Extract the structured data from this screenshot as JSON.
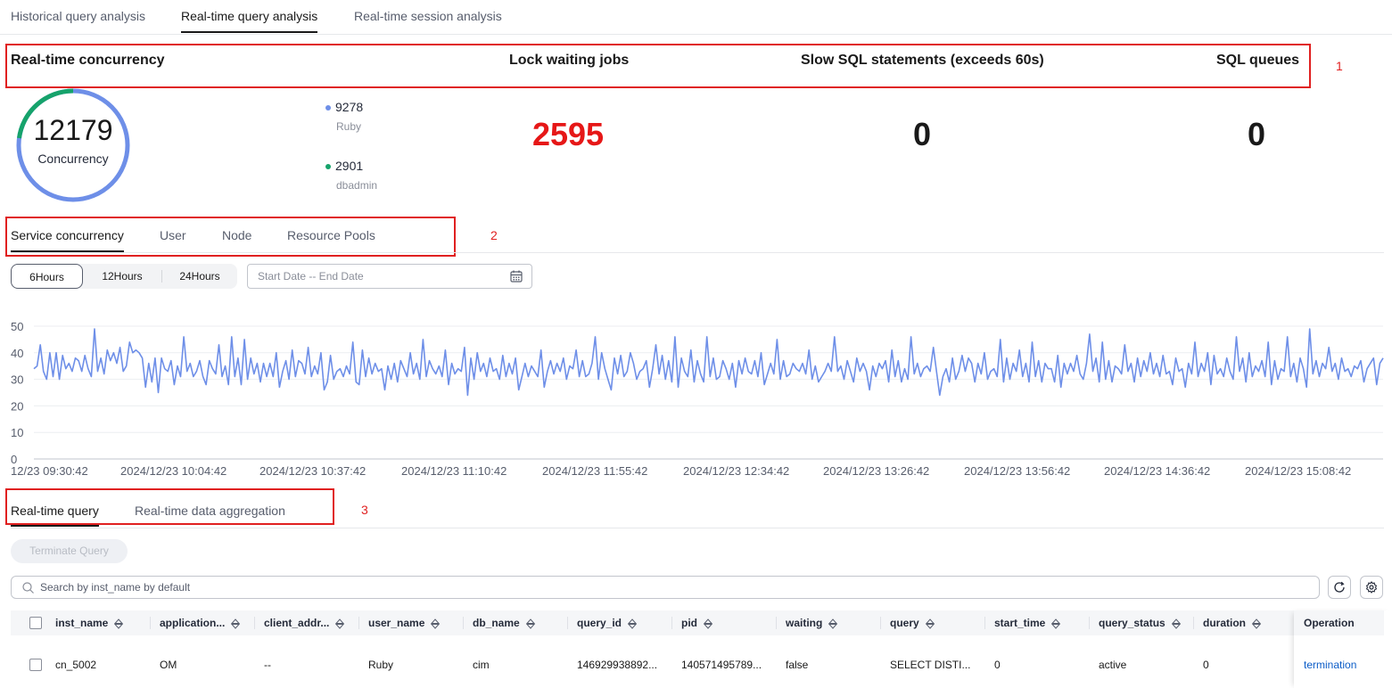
{
  "top_tabs": [
    "Historical query analysis",
    "Real-time query analysis",
    "Real-time session analysis"
  ],
  "metrics": {
    "realtime_title": "Real-time concurrency",
    "lock_title": "Lock waiting jobs",
    "slow_title": "Slow SQL statements (exceeds 60s)",
    "queues_title": "SQL queues",
    "concurrency_value": "12179",
    "concurrency_label": "Concurrency",
    "lock_value": "2595",
    "slow_value": "0",
    "queues_value": "0",
    "breakdown": [
      {
        "value": "9278",
        "user": "Ruby",
        "color": "#6e8fe8"
      },
      {
        "value": "2901",
        "user": "dbadmin",
        "color": "#16a36b"
      }
    ]
  },
  "annotations": [
    "1",
    "2",
    "3"
  ],
  "service_tabs": [
    "Service concurrency",
    "User",
    "Node",
    "Resource Pools"
  ],
  "time_range": {
    "options": [
      "6Hours",
      "12Hours",
      "24Hours"
    ],
    "selected": "6Hours",
    "date_placeholder": "Start Date -- End Date"
  },
  "chart_data": {
    "type": "line",
    "ylim": [
      0,
      50
    ],
    "yticks": [
      0,
      10,
      20,
      30,
      40,
      50
    ],
    "x_tick_labels": [
      "12/23 09:30:42",
      "2024/12/23 10:04:42",
      "2024/12/23 10:37:42",
      "2024/12/23 11:10:42",
      "2024/12/23 11:55:42",
      "2024/12/23 12:34:42",
      "2024/12/23 13:26:42",
      "2024/12/23 13:56:42",
      "2024/12/23 14:36:42",
      "2024/12/23 15:08:42"
    ],
    "color": "#6e8fe8",
    "series": [
      {
        "values": [
          34,
          35,
          43,
          33,
          30,
          40,
          31,
          40,
          30,
          39,
          34,
          36,
          33,
          38,
          37,
          33,
          39,
          34,
          31,
          49,
          33,
          38,
          32,
          41,
          37,
          40,
          36,
          42,
          33,
          35,
          44,
          40,
          41,
          40,
          38,
          27,
          36,
          29,
          38,
          25,
          38,
          34,
          33,
          37,
          28,
          35,
          31,
          46,
          33,
          36,
          31,
          33,
          37,
          31,
          28,
          37,
          34,
          32,
          43,
          31,
          35,
          28,
          46,
          31,
          38,
          28,
          45,
          30,
          38,
          32,
          36,
          29,
          36,
          31,
          36,
          31,
          40,
          27,
          33,
          37,
          30,
          41,
          31,
          37,
          36,
          32,
          42,
          31,
          35,
          32,
          40,
          26,
          29,
          39,
          30,
          33,
          34,
          31,
          35,
          32,
          44,
          29,
          28,
          41,
          31,
          38,
          32,
          36,
          33,
          34,
          26,
          35,
          30,
          36,
          29,
          37,
          34,
          31,
          40,
          32,
          36,
          30,
          45,
          31,
          37,
          34,
          32,
          35,
          31,
          41,
          28,
          36,
          32,
          34,
          33,
          42,
          24,
          38,
          30,
          40,
          33,
          36,
          31,
          38,
          33,
          34,
          30,
          39,
          31,
          36,
          32,
          38,
          26,
          31,
          36,
          31,
          35,
          33,
          31,
          41,
          27,
          33,
          37,
          32,
          36,
          33,
          38,
          30,
          35,
          34,
          41,
          31,
          37,
          31,
          32,
          36,
          46,
          30,
          40,
          34,
          30,
          26,
          38,
          32,
          39,
          31,
          33,
          40,
          36,
          30,
          33,
          34,
          37,
          27,
          34,
          43,
          32,
          39,
          30,
          37,
          29,
          46,
          27,
          38,
          33,
          31,
          41,
          29,
          37,
          32,
          29,
          46,
          31,
          38,
          30,
          31,
          37,
          34,
          30,
          36,
          27,
          37,
          32,
          38,
          33,
          32,
          37,
          31,
          40,
          28,
          32,
          36,
          32,
          45,
          30,
          37,
          31,
          32,
          36,
          34,
          33,
          36,
          32,
          41,
          30,
          35,
          29,
          31,
          33,
          36,
          33,
          46,
          33,
          35,
          30,
          37,
          33,
          29,
          38,
          33,
          36,
          33,
          26,
          35,
          31,
          36,
          34,
          37,
          29,
          41,
          31,
          37,
          29,
          34,
          30,
          46,
          32,
          36,
          31,
          34,
          35,
          33,
          42,
          33,
          24,
          31,
          34,
          29,
          38,
          30,
          33,
          39,
          33,
          38,
          36,
          29,
          36,
          32,
          40,
          30,
          33,
          34,
          31,
          45,
          29,
          38,
          30,
          36,
          33,
          41,
          31,
          36,
          29,
          44,
          31,
          37,
          29,
          36,
          34,
          34,
          29,
          39,
          27,
          36,
          32,
          36,
          33,
          39,
          32,
          30,
          36,
          47,
          33,
          38,
          29,
          44,
          30,
          37,
          29,
          35,
          34,
          32,
          43,
          33,
          36,
          29,
          38,
          31,
          37,
          33,
          40,
          32,
          36,
          31,
          39,
          32,
          33,
          28,
          38,
          33,
          34,
          27,
          36,
          32,
          44,
          31,
          36,
          33,
          40,
          28,
          39,
          32,
          34,
          31,
          38,
          33,
          30,
          46,
          33,
          38,
          29,
          40,
          31,
          35,
          33,
          37,
          31,
          44,
          28,
          37,
          30,
          34,
          33,
          46,
          31,
          36,
          29,
          38,
          34,
          27,
          49,
          32,
          37,
          31,
          36,
          34,
          42,
          33,
          36,
          30,
          38,
          33,
          34,
          31,
          35,
          34,
          37,
          29,
          34,
          36,
          38,
          28,
          36,
          38
        ]
      }
    ]
  },
  "bottom_tabs": [
    "Real-time query",
    "Real-time data aggregation"
  ],
  "terminate_label": "Terminate Query",
  "search_placeholder": "Search by inst_name by default",
  "table": {
    "columns": [
      "inst_name",
      "application...",
      "client_addr...",
      "user_name",
      "db_name",
      "query_id",
      "pid",
      "waiting",
      "query",
      "start_time",
      "query_status",
      "duration"
    ],
    "operation_header": "Operation",
    "rows": [
      {
        "cells": [
          "cn_5002",
          "OM",
          "--",
          "Ruby",
          "cim",
          "146929938892...",
          "140571495789...",
          "false",
          "SELECT DISTI...",
          "0",
          "active",
          "0"
        ],
        "operation": "termination"
      }
    ]
  }
}
